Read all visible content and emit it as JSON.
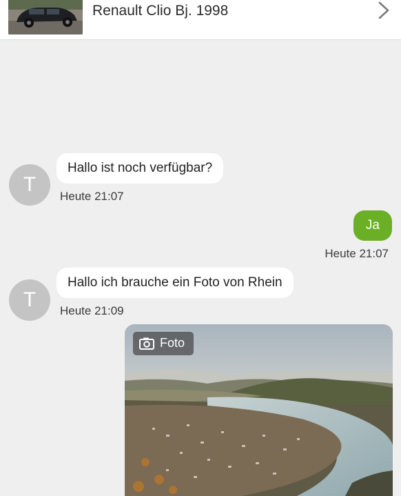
{
  "header": {
    "listing_title": "Renault Clio Bj. 1998",
    "thumbnail_icon": "car-photo",
    "chevron_icon": "chevron-right-icon"
  },
  "messages": [
    {
      "direction": "incoming",
      "avatar_letter": "T",
      "text": "Hallo ist noch verfügbar?",
      "time": "Heute 21:07"
    },
    {
      "direction": "outgoing",
      "text": "Ja",
      "time": "Heute 21:07"
    },
    {
      "direction": "incoming",
      "avatar_letter": "T",
      "text": "Hallo ich brauche ein Foto von Rhein",
      "time": "Heute 21:09"
    }
  ],
  "photo": {
    "badge_label": "Foto",
    "badge_icon": "camera-icon"
  },
  "colors": {
    "background": "#efefef",
    "outgoing_bubble": "#6aaf26",
    "incoming_bubble": "#ffffff",
    "avatar": "#c4c4c4"
  }
}
